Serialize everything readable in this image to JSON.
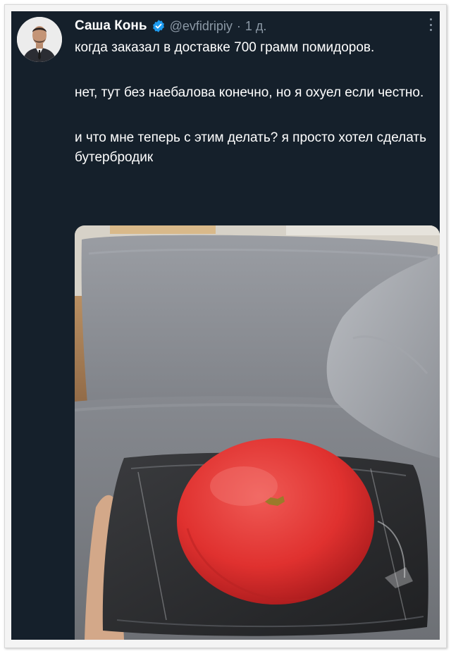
{
  "tweet": {
    "author_name": "Саша Конь",
    "handle": "@evfidripiy",
    "separator": "·",
    "time": "1 д.",
    "paragraphs": [
      "когда заказал в доставке 700 грамм помидоров.",
      "нет, тут без наебалова конечно, но я охуел если честно.",
      "и что мне теперь с этим делать? я просто хотел сделать бутербродик"
    ],
    "icons": {
      "verified": "verified-badge-icon",
      "more": "more-vertical-icon"
    },
    "colors": {
      "background": "#15202b",
      "text": "#ffffff",
      "secondary": "#8b98a5",
      "verified": "#1d9bf0"
    }
  }
}
